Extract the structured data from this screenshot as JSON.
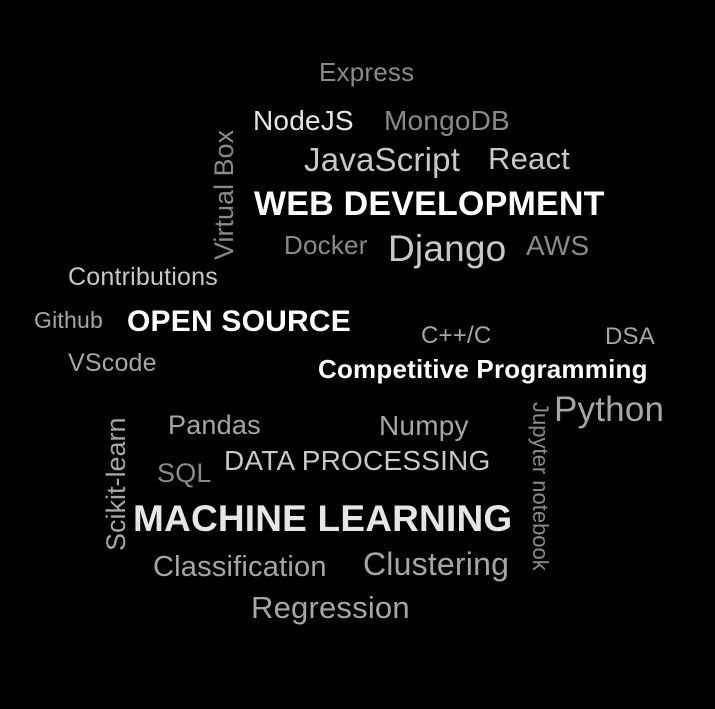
{
  "word_cloud": {
    "background": "#000000",
    "words": {
      "express": "Express",
      "nodejs": "NodeJS",
      "mongodb": "MongoDB",
      "javascript": "JavaScript",
      "react": "React",
      "virtual_box": "Virtual Box",
      "web_development": "WEB DEVELOPMENT",
      "docker": "Docker",
      "django": "Django",
      "aws": "AWS",
      "contributions": "Contributions",
      "github": "Github",
      "open_source": "OPEN SOURCE",
      "cpp": "C++/C",
      "dsa": "DSA",
      "vscode": "VScode",
      "competitive_programming": "Competitive Programming",
      "python": "Python",
      "scikit_learn": "Scikit-learn",
      "pandas": "Pandas",
      "numpy": "Numpy",
      "jupyter_notebook": "Jupyter notebook",
      "sql": "SQL",
      "data_processing": "DATA PROCESSING",
      "machine_learning": "MACHINE LEARNING",
      "classification": "Classification",
      "clustering": "Clustering",
      "regression": "Regression"
    },
    "colors": {
      "white": "#ffffff",
      "light": "#e6e6e6",
      "silver": "#c8c8c8",
      "gray": "#a6a6a6",
      "dim": "#8a8a8a"
    }
  }
}
